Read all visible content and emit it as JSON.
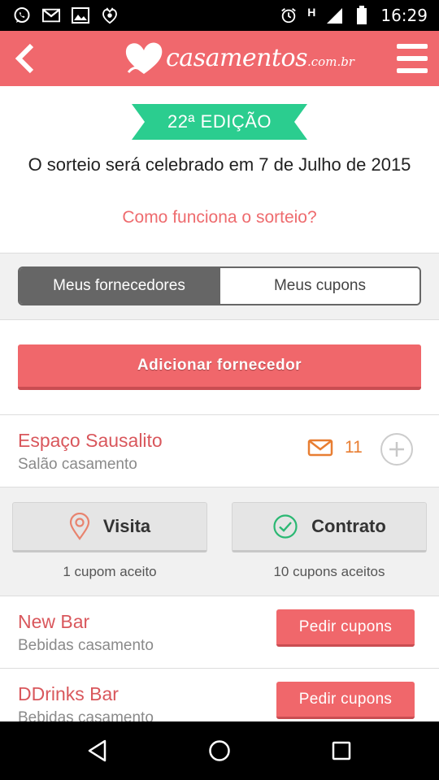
{
  "status_bar": {
    "time": "16:29",
    "network_label": "H",
    "icons": [
      "whatsapp-icon",
      "gmail-icon",
      "gallery-icon",
      "app-icon",
      "alarm-icon",
      "signal-icon",
      "battery-icon"
    ]
  },
  "app_bar": {
    "logo_text": "casamentos",
    "logo_suffix": ".com.br",
    "back_icon": "back-chevron-icon",
    "menu_icon": "hamburger-menu-icon",
    "color": "#f0686d"
  },
  "draw": {
    "edition": "22ª EDIÇÃO",
    "edition_color": "#2bcd8f",
    "description": "O sorteio será celebrado em 7 de Julho de 2015",
    "how_link": "Como funciona o sorteio?"
  },
  "tabs": {
    "active": "Meus fornecedores",
    "inactive": "Meus cupons"
  },
  "add_button": "Adicionar fornecedor",
  "vendors": [
    {
      "name": "Espaço Sausalito",
      "category": "Salão casamento",
      "message_count": "11",
      "coupons": [
        {
          "label": "Visita",
          "caption": "1 cupom aceito",
          "icon": "location-pin-icon"
        },
        {
          "label": "Contrato",
          "caption": "10 cupons aceitos",
          "icon": "check-circle-icon"
        }
      ]
    },
    {
      "name": "New Bar",
      "category": "Bebidas casamento",
      "action": "Pedir cupons"
    },
    {
      "name": "DDrinks Bar",
      "category": "Bebidas casamento",
      "action": "Pedir cupons"
    }
  ],
  "nav_bar": {
    "icons": [
      "back-triangle-icon",
      "home-circle-icon",
      "recents-square-icon"
    ]
  },
  "colors": {
    "accent": "#f0676b",
    "vendor_name": "#d9575c",
    "message": "#e87e32",
    "success": "#2bb873"
  }
}
